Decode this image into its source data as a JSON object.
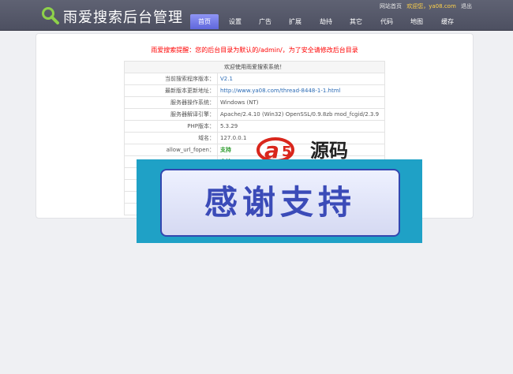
{
  "header": {
    "app_title": "雨爱搜索后台管理",
    "links": {
      "site_home": "网站首页",
      "welcome": "欢迎您，ya08.com",
      "logout": "退出"
    },
    "nav": [
      "首页",
      "设置",
      "广告",
      "扩展",
      "劫持",
      "其它",
      "代码",
      "地图",
      "缓存"
    ],
    "active_nav": "首页"
  },
  "main": {
    "warning": "雨爱搜索提醒：您的后台目录为默认的/admin/，为了安全请修改后台目录",
    "table_caption": "欢迎使用雨爱搜索系统！",
    "rows": [
      {
        "label": "当前搜索程序版本：",
        "value": "V2.1"
      },
      {
        "label": "最新版本更新地址：",
        "value": "http://www.ya08.com/thread-8448-1-1.html"
      },
      {
        "label": "服务器操作系统：",
        "value": "Windows (NT)"
      },
      {
        "label": "服务器解译引擎：",
        "value": "Apache/2.4.10 (Win32) OpenSSL/0.9.8zb mod_fcgid/2.3.9"
      },
      {
        "label": "PHP版本：",
        "value": "5.3.29"
      },
      {
        "label": "域名：",
        "value": "127.0.0.1"
      },
      {
        "label": "allow_url_fopen：",
        "value": "支持"
      },
      {
        "label": "",
        "value": "支持"
      },
      {
        "label": "",
        "value": ""
      },
      {
        "label": "",
        "value": ""
      },
      {
        "label": "",
        "value": ""
      },
      {
        "label": "",
        "value": ""
      }
    ]
  },
  "overlay": {
    "watermark_text": "源码",
    "banner_text": "感谢支持"
  },
  "colors": {
    "header_bg": "#565a6b",
    "nav_active": "#7a80ea",
    "warning": "#ff0000",
    "link": "#2b6bb5",
    "support": "#2a9a2a",
    "banner_bg": "#1fa1c6",
    "banner_text": "#3b4bb8"
  }
}
